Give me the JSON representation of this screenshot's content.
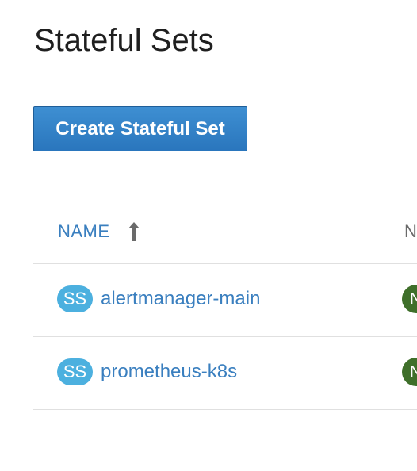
{
  "page": {
    "title": "Stateful Sets"
  },
  "toolbar": {
    "create_label": "Create Stateful Set"
  },
  "table": {
    "columns": [
      {
        "label": "NAME",
        "sorted": "ascending"
      },
      {
        "label": "N"
      }
    ],
    "rows": [
      {
        "kind_badge": "SS",
        "name": "alertmanager-main",
        "namespace_badge": "N"
      },
      {
        "kind_badge": "SS",
        "name": "prometheus-k8s",
        "namespace_badge": "N"
      }
    ]
  },
  "icons": {
    "sort": "arrow-up-icon"
  },
  "colors": {
    "link": "#3a7fbf",
    "primary_button": "#2a76bd",
    "resource_badge": "#4cb0df",
    "namespace_badge": "#3f6f2a"
  }
}
